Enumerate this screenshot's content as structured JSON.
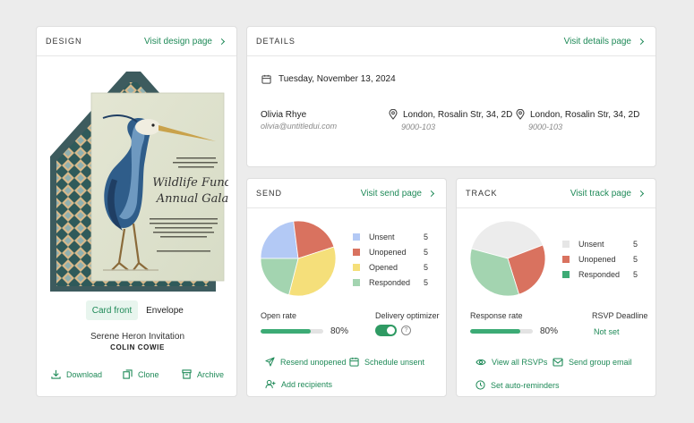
{
  "design": {
    "title": "DESIGN",
    "link": "Visit design page",
    "tabs": [
      {
        "label": "Card front",
        "active": true
      },
      {
        "label": "Envelope",
        "active": false
      }
    ],
    "card_name": "Serene Heron Invitation",
    "card_author": "COLIN COWIE",
    "actions": [
      "Download",
      "Clone",
      "Archive"
    ],
    "invite_text": {
      "intro": "PLEASE JOIN US FOR AN EDUCATIONAL EVENING OF PHILANTHROPY AT THE",
      "headline1": "Wildlife Funds",
      "headline2": "Annual Gala",
      "details": "AT FIVE O'CLOCK IN THE EVENING ON THE TWENTY-SEVENTH OF MAY TWO THOUSAND TWENTY SHERWOOD MEADOWS RANCH LAKEVIEW, VERMONT",
      "footer": "Further information on Website Page"
    }
  },
  "details": {
    "title": "DETAILS",
    "link": "Visit details page",
    "date": "Tuesday, November 13, 2024",
    "host_name": "Olivia Rhye",
    "host_email": "olivia@untitledui.com",
    "locations": [
      {
        "address": "London, Rosalin Str, 34, 2D",
        "code": "9000-103"
      },
      {
        "address": "London, Rosalin Str, 34, 2D",
        "code": "9000-103"
      }
    ]
  },
  "send": {
    "title": "SEND",
    "link": "Visit send page",
    "legend": [
      {
        "label": "Unsent",
        "value": "5",
        "color": "#b3c9f5"
      },
      {
        "label": "Unopened",
        "value": "5",
        "color": "#d9725f"
      },
      {
        "label": "Opened",
        "value": "5",
        "color": "#f5df7a"
      },
      {
        "label": "Responded",
        "value": "5",
        "color": "#a3d4b0"
      }
    ],
    "open_rate_label": "Open rate",
    "open_rate_value": "80%",
    "open_rate_fraction": 0.8,
    "delivery_label": "Delivery optimizer",
    "delivery_on": true,
    "actions": [
      "Resend unopened",
      "Schedule unsent",
      "Add recipients"
    ]
  },
  "track": {
    "title": "TRACK",
    "link": "Visit track page",
    "legend": [
      {
        "label": "Unsent",
        "value": "5",
        "color": "#ececec"
      },
      {
        "label": "Unopened",
        "value": "5",
        "color": "#d9725f"
      },
      {
        "label": "Responded",
        "value": "5",
        "color": "#3cab75"
      }
    ],
    "response_rate_label": "Response rate",
    "response_rate_value": "80%",
    "response_rate_fraction": 0.8,
    "rsvp_label": "RSVP Deadline",
    "rsvp_value": "Not set",
    "actions": [
      "View all RSVPs",
      "Send group email",
      "Set auto-reminders"
    ]
  },
  "chart_data": [
    {
      "type": "pie",
      "categories": [
        "Unsent",
        "Unopened",
        "Opened",
        "Responded"
      ],
      "values": [
        23,
        22,
        34,
        21
      ],
      "colors": [
        "#b3c9f5",
        "#d9725f",
        "#f5df7a",
        "#a3d4b0"
      ]
    },
    {
      "type": "pie",
      "categories": [
        "Unsent",
        "Unopened",
        "Responded"
      ],
      "values": [
        40,
        26,
        34
      ],
      "colors": [
        "#ececec",
        "#d9725f",
        "#a3d4b0"
      ]
    }
  ]
}
